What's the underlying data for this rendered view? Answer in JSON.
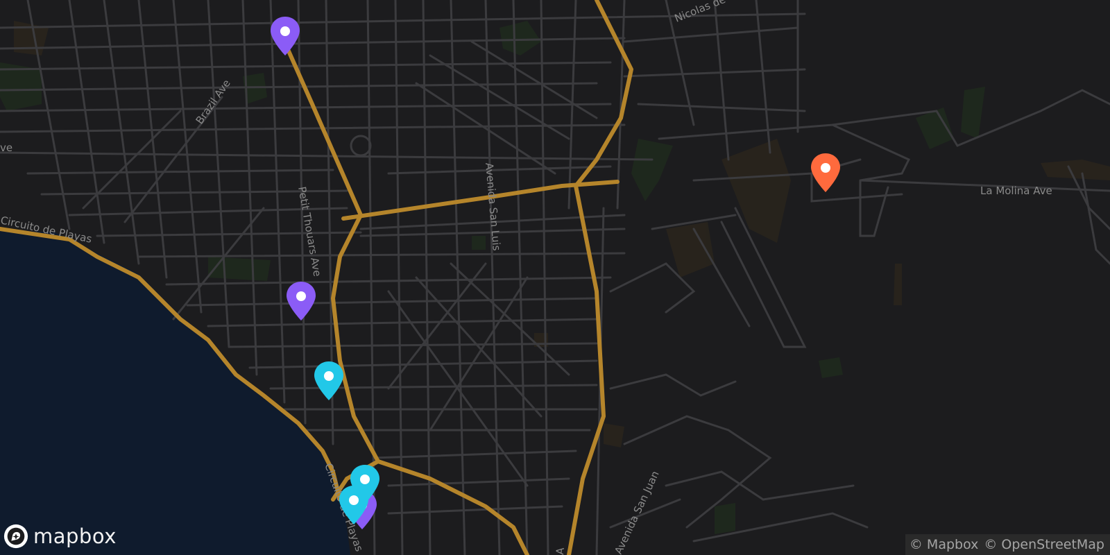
{
  "map": {
    "street_labels": [
      "Brazil Ave",
      "Petit Thouars Ave",
      "Avenida San Luis",
      "La Molina Ave",
      "Nicolas de",
      "Circuito de Playas",
      "Circuito de Playas",
      "Avenida San Juan",
      "ve",
      "A"
    ],
    "colors": {
      "water": "#0f1b2d",
      "land": "#1c1c1e",
      "street": "#3d3d40",
      "highway": "#b5852b",
      "park": "#1f2a1d",
      "marker_purple": "#8b5cf6",
      "marker_cyan": "#22c8e8",
      "marker_orange": "#ff6a3d"
    },
    "markers": [
      {
        "name": "marker-purple-1",
        "color": "purple"
      },
      {
        "name": "marker-purple-2",
        "color": "purple"
      },
      {
        "name": "marker-cyan-1",
        "color": "cyan"
      },
      {
        "name": "marker-cyan-2",
        "color": "cyan"
      },
      {
        "name": "marker-cyan-3",
        "color": "cyan"
      },
      {
        "name": "marker-purple-3",
        "color": "purple"
      },
      {
        "name": "marker-orange-1",
        "color": "orange"
      }
    ]
  },
  "logo": {
    "text": "mapbox",
    "icon": "mapbox-logo-icon"
  },
  "attribution": {
    "mapbox": "© Mapbox",
    "osm": "© OpenStreetMap"
  }
}
